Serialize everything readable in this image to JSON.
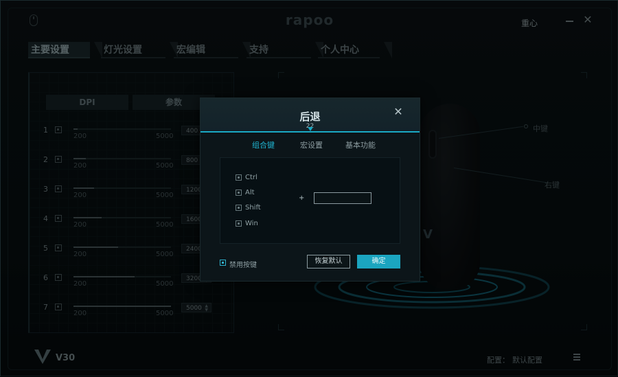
{
  "app": {
    "logo": "rapoo",
    "reset_label": "重心",
    "model": "V30"
  },
  "tabs": [
    {
      "label": "主要设置",
      "active": true
    },
    {
      "label": "灯光设置",
      "active": false
    },
    {
      "label": "宏编辑",
      "active": false
    },
    {
      "label": "支持",
      "active": false
    },
    {
      "label": "个人中心",
      "active": false
    }
  ],
  "dpi_panel": {
    "sub_tabs": [
      "DPI",
      "参数"
    ],
    "rows": [
      {
        "index": "1",
        "min": "200",
        "max": "5000",
        "value": "400",
        "level": 0.04
      },
      {
        "index": "2",
        "min": "200",
        "max": "5000",
        "value": "800",
        "level": 0.13
      },
      {
        "index": "3",
        "min": "200",
        "max": "5000",
        "value": "1200",
        "level": 0.21
      },
      {
        "index": "4",
        "min": "200",
        "max": "5000",
        "value": "1600",
        "level": 0.29
      },
      {
        "index": "5",
        "min": "200",
        "max": "5000",
        "value": "2400",
        "level": 0.46
      },
      {
        "index": "6",
        "min": "200",
        "max": "5000",
        "value": "3200",
        "level": 0.63
      },
      {
        "index": "7",
        "min": "200",
        "max": "5000",
        "value": "5000",
        "level": 1.0
      }
    ]
  },
  "mouse_labels": {
    "middle": "中键",
    "right": "右键"
  },
  "footer": {
    "profile_label": "配置：",
    "profile_value": "默认配置"
  },
  "dialog": {
    "title": "后退",
    "key_code": "22",
    "tabs": [
      {
        "label": "组合键",
        "active": true
      },
      {
        "label": "宏设置",
        "active": false
      },
      {
        "label": "基本功能",
        "active": false
      }
    ],
    "modifiers": [
      "Ctrl",
      "Alt",
      "Shift",
      "Win"
    ],
    "plus": "+",
    "key_value": "",
    "disable_label": "禁用按键",
    "restore_button": "恢复默认",
    "confirm_button": "确定",
    "close_glyph": "✕"
  },
  "colors": {
    "accent": "#1ba5c0",
    "background": "#081012"
  }
}
